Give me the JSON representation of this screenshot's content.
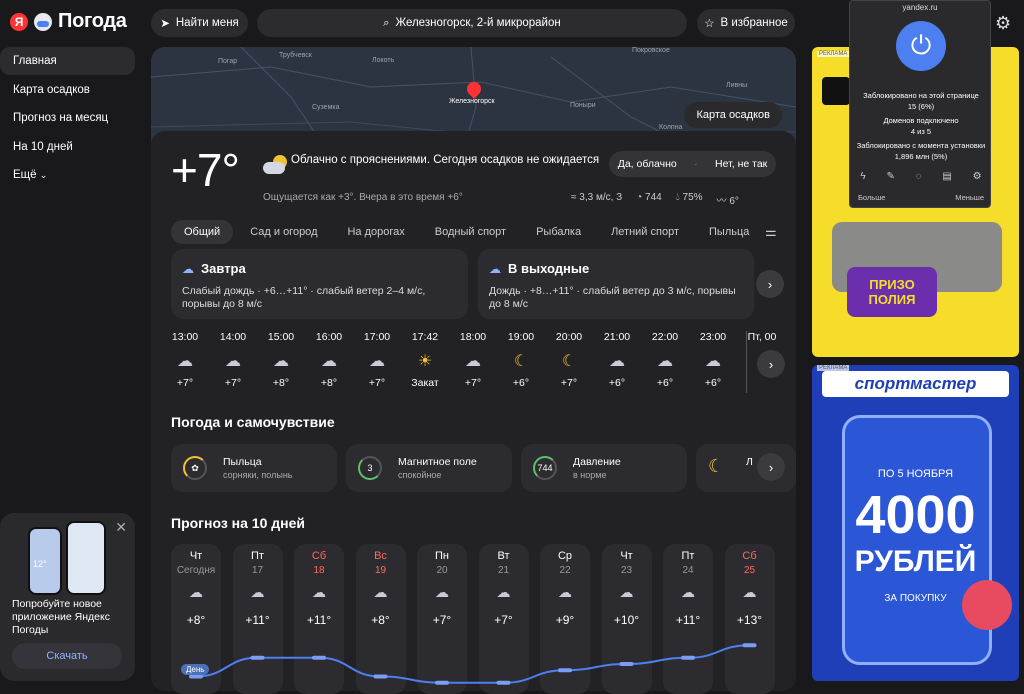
{
  "logo": {
    "letter": "Я",
    "text": "Погода"
  },
  "nav": [
    "Главная",
    "Карта осадков",
    "Прогноз на месяц",
    "На 10 дней",
    "Ещё"
  ],
  "promo": {
    "text": "Попробуйте новое приложение Яндекс Погоды",
    "button": "Скачать",
    "temp": "12°"
  },
  "topbar": {
    "find": "Найти меня",
    "search": "Железногорск, 2-й микрорайон",
    "fav": "В избранное"
  },
  "map": {
    "button": "Карта осадков",
    "labels": [
      "Трубчевск",
      "Погар",
      "Локоть",
      "Покровское",
      "Железногорск",
      "Суземка",
      "Поныри",
      "Ливны",
      "Колпна"
    ]
  },
  "current": {
    "temp": "+7°",
    "condition": "Облачно с прояснениями. Сегодня осадков не ожидается",
    "feels": "Ощущается как +3°. Вчера в это время +6°",
    "feedback_yes": "Да, облачно",
    "feedback_no": "Нет, не так",
    "wind": "3,3 м/с, З",
    "pressure": "744",
    "humidity": "75%",
    "water": "6°"
  },
  "tabs": [
    "Общий",
    "Сад и огород",
    "На дорогах",
    "Водный спорт",
    "Рыбалка",
    "Летний спорт",
    "Пыльца"
  ],
  "forecast_cards": [
    {
      "title": "Завтра",
      "text": "Слабый дождь · +6…+11° · слабый ветер 2–4 м/с, порывы до 8 м/с"
    },
    {
      "title": "В выходные",
      "text": "Дождь · +8…+11° · слабый ветер до 3 м/с, порывы до 8 м/с"
    }
  ],
  "hourly": [
    {
      "time": "13:00",
      "temp": "+7°",
      "icon": "partly-cloudy-icon"
    },
    {
      "time": "14:00",
      "temp": "+7°",
      "icon": "partly-cloudy-icon"
    },
    {
      "time": "15:00",
      "temp": "+8°",
      "icon": "partly-cloudy-icon"
    },
    {
      "time": "16:00",
      "temp": "+8°",
      "icon": "cloudy-icon"
    },
    {
      "time": "17:00",
      "temp": "+7°",
      "icon": "cloudy-icon"
    },
    {
      "time": "17:42",
      "temp": "Закат",
      "icon": "sunset-icon"
    },
    {
      "time": "18:00",
      "temp": "+7°",
      "icon": "cloudy-icon"
    },
    {
      "time": "19:00",
      "temp": "+6°",
      "icon": "moon-icon"
    },
    {
      "time": "20:00",
      "temp": "+7°",
      "icon": "moon-icon"
    },
    {
      "time": "21:00",
      "temp": "+6°",
      "icon": "cloudy-night-icon"
    },
    {
      "time": "22:00",
      "temp": "+6°",
      "icon": "cloudy-night-icon"
    },
    {
      "time": "23:00",
      "temp": "+6°",
      "icon": "partly-cloudy-night-icon"
    },
    {
      "time": "Пт, 00",
      "temp": "",
      "icon": ""
    }
  ],
  "wellbeing": {
    "title": "Погода и самочувствие",
    "items": [
      {
        "label": "Пыльца",
        "sub": "сорняки, полынь",
        "value": ""
      },
      {
        "label": "Магнитное поле",
        "sub": "спокойное",
        "value": "3"
      },
      {
        "label": "Давление",
        "sub": "в норме",
        "value": "744"
      },
      {
        "label": "Л",
        "sub": "",
        "value": ""
      }
    ]
  },
  "ten_days": {
    "title": "Прогноз на 10 дней",
    "days": [
      {
        "name": "Чт",
        "date": "Сегодня",
        "temp": "+8°",
        "weekend": false
      },
      {
        "name": "Пт",
        "date": "17",
        "temp": "+11°",
        "weekend": false
      },
      {
        "name": "Сб",
        "date": "18",
        "temp": "+11°",
        "weekend": true
      },
      {
        "name": "Вс",
        "date": "19",
        "temp": "+8°",
        "weekend": true
      },
      {
        "name": "Пн",
        "date": "20",
        "temp": "+7°",
        "weekend": false
      },
      {
        "name": "Вт",
        "date": "21",
        "temp": "+7°",
        "weekend": false
      },
      {
        "name": "Ср",
        "date": "22",
        "temp": "+9°",
        "weekend": false
      },
      {
        "name": "Чт",
        "date": "23",
        "temp": "+10°",
        "weekend": false
      },
      {
        "name": "Пт",
        "date": "24",
        "temp": "+11°",
        "weekend": false
      },
      {
        "name": "Сб",
        "date": "25",
        "temp": "+13°",
        "weekend": true
      }
    ],
    "legend": "День"
  },
  "chart_data": {
    "type": "line",
    "categories": [
      "Чт",
      "Пт",
      "Сб",
      "Вс",
      "Пн",
      "Вт",
      "Ср",
      "Чт",
      "Пт",
      "Сб"
    ],
    "series": [
      {
        "name": "День",
        "values": [
          8,
          11,
          11,
          8,
          7,
          7,
          9,
          10,
          11,
          13
        ]
      }
    ]
  },
  "ads": {
    "tag": "РЕКЛАМА",
    "ad1_title": "ПРИЗО ПОЛИЯ",
    "ad2_brand": "спортмастер",
    "ad2_line1": "ПО 5 НОЯБРЯ",
    "ad2_amount": "4000",
    "ad2_currency": "РУБЛЕЙ",
    "ad2_line2": "ЗА ПОКУПКУ"
  },
  "popup": {
    "title": "yandex.ru",
    "blocked_label": "Заблокировано на этой странице",
    "blocked_value": "15 (6%)",
    "domains_label": "Доменов подключено",
    "domains_value": "4 из 5",
    "since_label": "Заблокировано с момента установки",
    "since_value": "1,896 млн (5%)",
    "more": "Больше",
    "less": "Меньше"
  },
  "colors": {
    "accent": "#4d7ff0",
    "weekend": "#ff6b5b",
    "sun": "#f2c233"
  }
}
